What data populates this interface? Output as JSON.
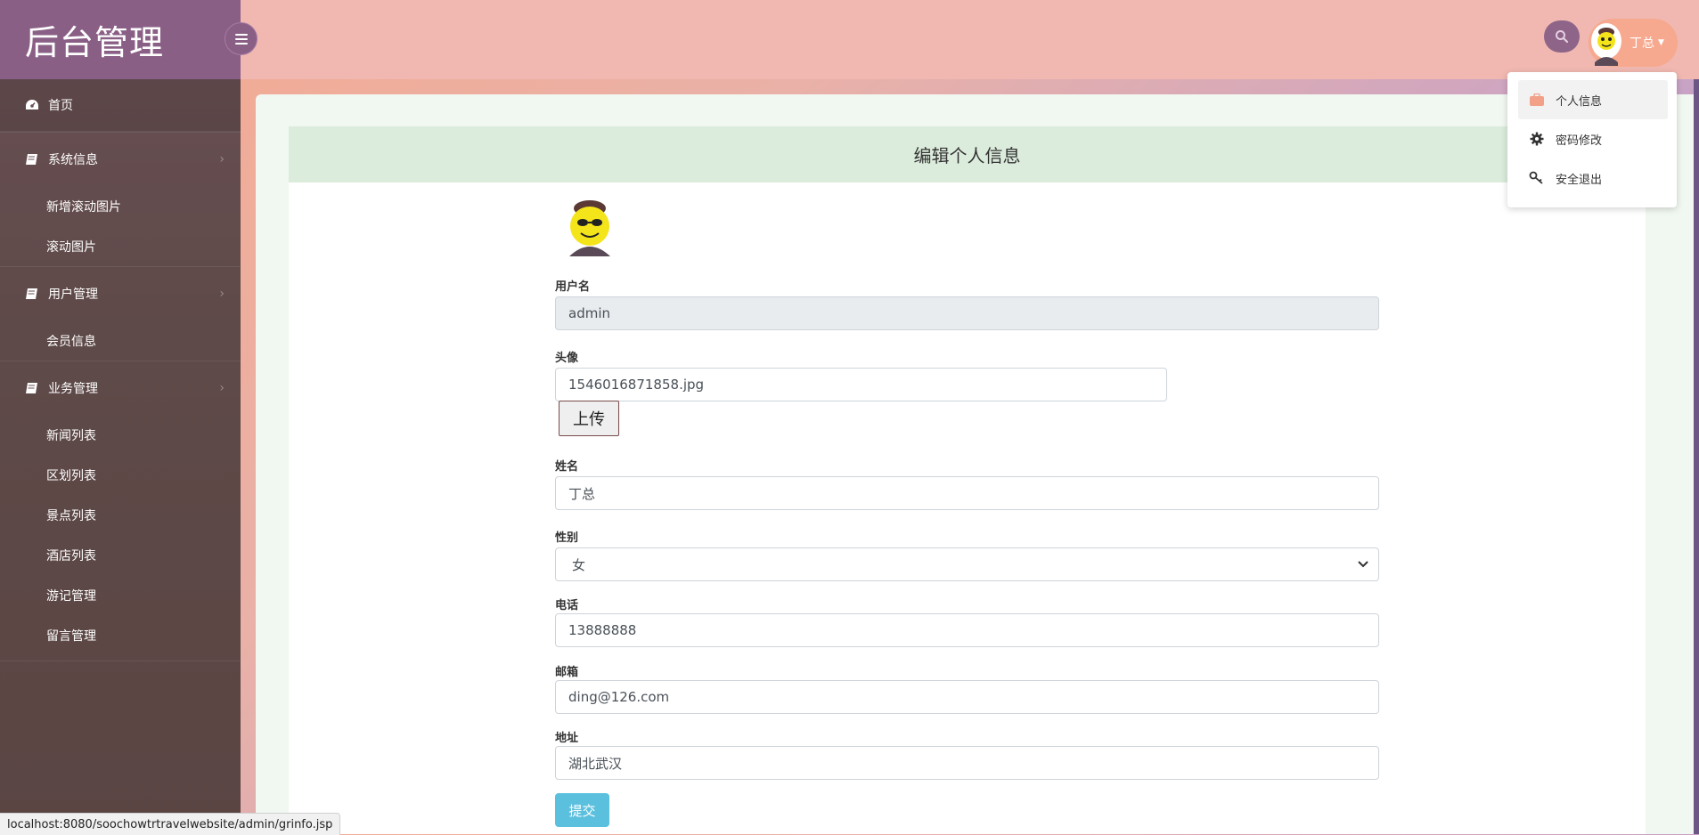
{
  "brand": {
    "title": "后台管理"
  },
  "sidebar": {
    "home": "首页",
    "groups": [
      {
        "label": "系统信息",
        "items": [
          "新增滚动图片",
          "滚动图片"
        ]
      },
      {
        "label": "用户管理",
        "items": [
          "会员信息"
        ]
      },
      {
        "label": "业务管理",
        "items": [
          "新闻列表",
          "区划列表",
          "景点列表",
          "酒店列表",
          "游记管理",
          "留言管理"
        ]
      }
    ]
  },
  "header": {
    "user_name": "丁总"
  },
  "dropdown": {
    "items": [
      "个人信息",
      "密码修改",
      "安全退出"
    ]
  },
  "form": {
    "title": "编辑个人信息",
    "username_label": "用户名",
    "username_value": "admin",
    "avatar_label": "头像",
    "avatar_value": "1546016871858.jpg",
    "upload_label": "上传",
    "name_label": "姓名",
    "name_value": "丁总",
    "gender_label": "性别",
    "gender_value": "女",
    "phone_label": "电话",
    "phone_value": "13888888",
    "email_label": "邮箱",
    "email_value": "ding@126.com",
    "address_label": "地址",
    "address_value": "湖北武汉",
    "submit_label": "提交"
  },
  "status_url": "localhost:8080/soochowtrtravelwebsite/admin/grinfo.jsp",
  "colors": {
    "accent": "#8a5f86",
    "header": "#f0b8b0",
    "submit": "#5bc0de"
  }
}
